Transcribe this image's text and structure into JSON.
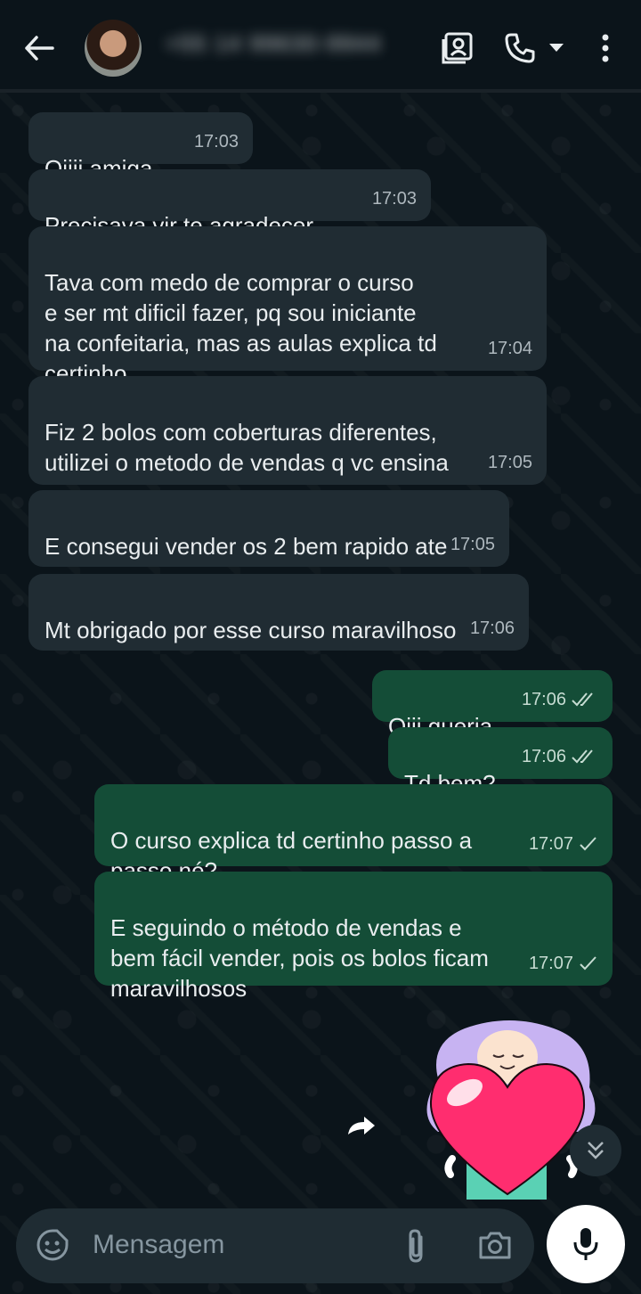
{
  "header": {
    "contact_name": "+55 14 99630-9944"
  },
  "messages": [
    {
      "direction": "in",
      "text": "Oiiii amiga",
      "time": "17:03"
    },
    {
      "direction": "in",
      "text": "Precisava vir te agradecer",
      "time": "17:03"
    },
    {
      "direction": "in",
      "text": "Tava com medo de comprar o curso\ne ser mt dificil fazer, pq sou iniciante\nna confeitaria, mas as aulas explica td\ncertinho",
      "time": "17:04"
    },
    {
      "direction": "in",
      "text": "Fiz 2 bolos com coberturas diferentes,\nutilizei o metodo de vendas q vc ensina",
      "time": "17:05"
    },
    {
      "direction": "in",
      "text": "E consegui vender os 2 bem rapido ate",
      "time": "17:05"
    },
    {
      "direction": "in",
      "text": "Mt obrigado por esse curso maravilhoso",
      "time": "17:06"
    },
    {
      "direction": "out",
      "text": "Oiii queria",
      "time": "17:06",
      "status": "read"
    },
    {
      "direction": "out",
      "text": "Td bem?",
      "time": "17:06",
      "status": "read"
    },
    {
      "direction": "out",
      "text": "O curso explica td certinho passo a\npasso né?",
      "time": "17:07",
      "status": "sent"
    },
    {
      "direction": "out",
      "text": "E seguindo o método de vendas e\nbem fácil vender,  pois os bolos ficam\nmaravilhosos",
      "time": "17:07",
      "status": "sent"
    }
  ],
  "input": {
    "placeholder": "Mensagem"
  },
  "colors": {
    "background": "#0b141a",
    "incoming_bubble": "#202c33",
    "outgoing_bubble": "#144d37",
    "input_bar": "#1f2c33"
  }
}
